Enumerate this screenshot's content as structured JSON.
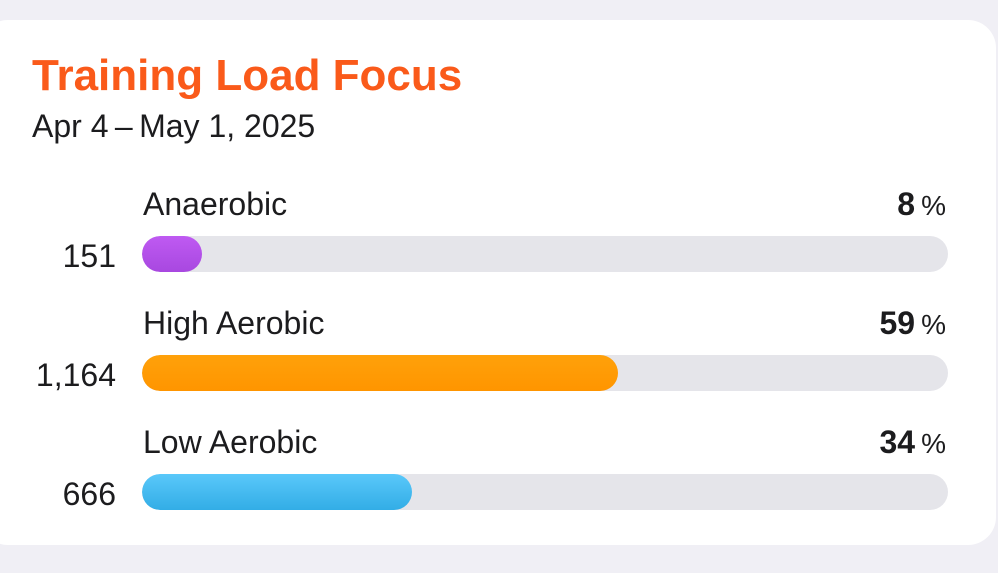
{
  "card": {
    "title": "Training Load Focus",
    "date_range": "Apr 4 – May 1, 2025"
  },
  "metrics": [
    {
      "label": "Anaerobic",
      "percent": "8",
      "percent_sign": "%",
      "count": "151",
      "fraction": 0.075,
      "color": "#bf5af2",
      "color_end": "#a848e0"
    },
    {
      "label": "High Aerobic",
      "percent": "59",
      "percent_sign": "%",
      "count": "1,164",
      "fraction": 0.59,
      "color": "#ffa10a",
      "color_end": "#ff9500"
    },
    {
      "label": "Low Aerobic",
      "percent": "34",
      "percent_sign": "%",
      "count": "666",
      "fraction": 0.335,
      "color": "#5ac8fa",
      "color_end": "#32ade6"
    }
  ],
  "colors": {
    "title": "#fa5a1a",
    "track": "#e5e5ea",
    "background": "#f0eff5",
    "card": "#ffffff"
  }
}
